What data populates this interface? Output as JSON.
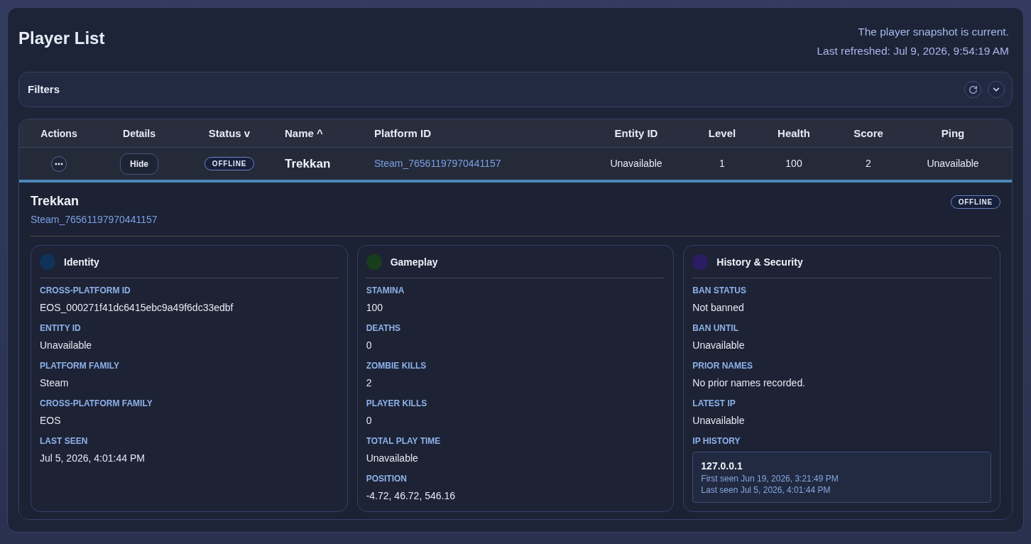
{
  "page": {
    "title": "Player List",
    "status_lines": [
      "The player snapshot is current.",
      "Last refreshed: Jul 9, 2026, 9:54:19 AM"
    ]
  },
  "filters": {
    "title": "Filters"
  },
  "table": {
    "columns": [
      "Actions",
      "Details",
      "Status v",
      "Name ^",
      "Platform ID",
      "Entity ID",
      "Level",
      "Health",
      "Score",
      "Ping"
    ],
    "rows": [
      {
        "details_button": "Hide",
        "status": "OFFLINE",
        "name": "Trekkan",
        "platform_id": "Steam_76561197970441157",
        "entity_id": "Unavailable",
        "player_level": "1",
        "health": "100",
        "score": "2",
        "ping": "Unavailable",
        "expanded": true
      }
    ]
  },
  "detail": {
    "name": "Trekkan",
    "platform_id": "Steam_76561197970441157",
    "status": "OFFLINE",
    "cards": [
      {
        "title": "Identity",
        "color": "#0f3358",
        "fields": [
          {
            "kind": "text",
            "label": "CROSS-PLATFORM ID",
            "value": "EOS_000271f41dc6415ebc9a49f6dc33edbf"
          },
          {
            "kind": "text",
            "label": "ENTITY ID",
            "value": "Unavailable"
          },
          {
            "kind": "text",
            "label": "PLATFORM FAMILY",
            "value": "Steam"
          },
          {
            "kind": "text",
            "label": "CROSS-PLATFORM FAMILY",
            "value": "EOS"
          },
          {
            "kind": "text",
            "label": "LAST SEEN",
            "value": "Jul 5, 2026, 4:01:44 PM"
          }
        ]
      },
      {
        "title": "Gameplay",
        "color": "#173d1c",
        "fields": [
          {
            "kind": "text",
            "label": "STAMINA",
            "value": "100"
          },
          {
            "kind": "text",
            "label": "DEATHS",
            "value": "0"
          },
          {
            "kind": "text",
            "label": "ZOMBIE KILLS",
            "value": "2"
          },
          {
            "kind": "text",
            "label": "PLAYER KILLS",
            "value": "0"
          },
          {
            "kind": "text",
            "label": "TOTAL PLAY TIME",
            "value": "Unavailable"
          },
          {
            "kind": "text",
            "label": "POSITION",
            "value": "-4.72, 46.72, 546.16"
          }
        ]
      },
      {
        "title": "History & Security",
        "color": "#2c1c62",
        "fields": [
          {
            "kind": "text",
            "label": "BAN STATUS",
            "value": "Not banned"
          },
          {
            "kind": "text",
            "label": "BAN UNTIL",
            "value": "Unavailable"
          },
          {
            "kind": "text",
            "label": "PRIOR NAMES",
            "value": "No prior names recorded."
          },
          {
            "kind": "text",
            "label": "LATEST IP",
            "value": "Unavailable"
          },
          {
            "kind": "ip_list",
            "label": "IP HISTORY",
            "entries": [
              {
                "ip": "127.0.0.1",
                "first_seen": "First seen Jun 19, 2026, 3:21:49 PM",
                "last_seen": "Last seen Jul 5, 2026, 4:01:44 PM"
              }
            ]
          }
        ]
      }
    ]
  }
}
